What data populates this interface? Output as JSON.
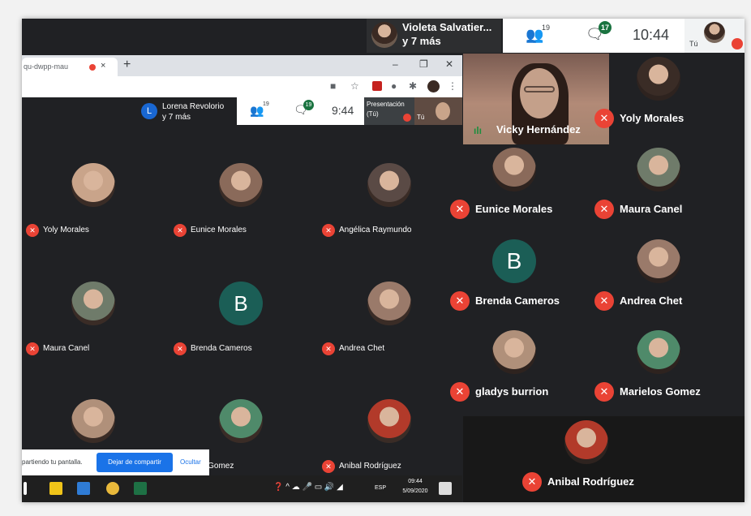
{
  "top_bar": {
    "presenter_name": "Violeta Salvatier...",
    "presenter_more": "y 7 más",
    "people_count": "19",
    "chat_count": "17",
    "time": "10:44",
    "you_label": "Tú"
  },
  "browser": {
    "tab_url": "qu-dwpp-mau",
    "tab_close": "×",
    "new_tab": "+",
    "win_min": "–",
    "win_max": "❐",
    "win_close": "✕"
  },
  "inner_meet": {
    "chip_letter": "L",
    "presenter_name": "Lorena Revolorio",
    "presenter_more": "y 7 más",
    "people_count": "19",
    "chat_count": "19",
    "time": "9:44",
    "presentation_label": "Presentación",
    "presentation_you": "(Tú)",
    "you_label": "Tú"
  },
  "left_grid": [
    {
      "name": "Yoly Morales",
      "type": "photo"
    },
    {
      "name": "Eunice Morales",
      "type": "photo"
    },
    {
      "name": "Angélica Raymundo",
      "type": "photo"
    },
    {
      "name": "Maura Canel",
      "type": "photo"
    },
    {
      "name": "Brenda Cameros",
      "type": "letter",
      "letter": "B"
    },
    {
      "name": "Andrea Chet",
      "type": "photo"
    },
    {
      "name": "",
      "type": "photo"
    },
    {
      "name": "elos Gomez",
      "type": "photo"
    },
    {
      "name": "Anibal Rodríguez",
      "type": "photo"
    }
  ],
  "share_bar": {
    "message": "partiendo tu pantalla.",
    "stop_button": "Dejar de compartir",
    "hide_button": "Ocultar"
  },
  "taskbar": {
    "lang": "ESP",
    "time": "09:44",
    "date": "5/09/2020"
  },
  "right_grid": {
    "speaker": "Vicky Hernández",
    "tiles": [
      {
        "name": "Yoly Morales",
        "type": "photo"
      },
      {
        "name": "Eunice Morales",
        "type": "photo"
      },
      {
        "name": "Maura Canel",
        "type": "photo"
      },
      {
        "name": "Brenda Cameros",
        "type": "letter",
        "letter": "B"
      },
      {
        "name": "Andrea Chet",
        "type": "photo"
      },
      {
        "name": "gladys burrion",
        "type": "photo"
      },
      {
        "name": "Marielos Gomez",
        "type": "photo"
      },
      {
        "name": "Anibal Rodríguez",
        "type": "photo"
      }
    ]
  },
  "colors": {
    "meet_bg": "#202124",
    "mic_off": "#ea4335",
    "badge": "#1a7340",
    "letter_avatar": "#1b5e56",
    "share_blue": "#1a73e8"
  }
}
